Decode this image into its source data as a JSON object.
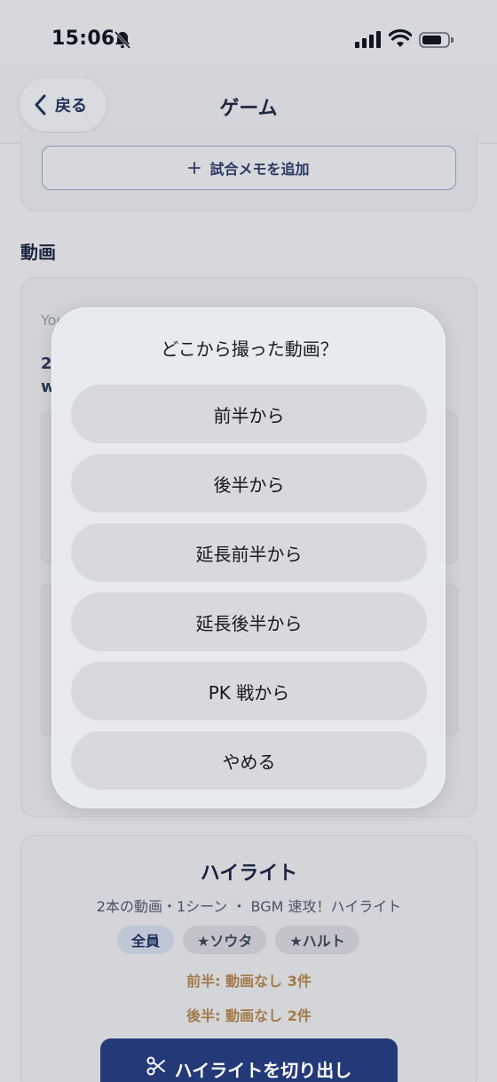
{
  "status_bar": {
    "time": "15:06"
  },
  "nav": {
    "back_label": "戻る",
    "title": "ゲーム"
  },
  "memo": {
    "add_label": "試合メモを追加"
  },
  "video_section": {
    "title": "動画",
    "hint": "You",
    "number": "2",
    "w": "w"
  },
  "highlight": {
    "title": "ハイライト",
    "subtitle": "2本の動画・1シーン ・ BGM 速攻！ハイライト",
    "chips": [
      "全員",
      "★ソウタ",
      "★ハルト"
    ],
    "warning_first_half": "前半: 動画なし 3件",
    "warning_second_half": "後半: 動画なし 2件",
    "cut_button_label": "ハイライトを切り出し"
  },
  "action_sheet": {
    "title": "どこから撮った動画？",
    "options": [
      "前半から",
      "後半から",
      "延長前半から",
      "延長後半から",
      "PK 戦から"
    ],
    "cancel": "やめる"
  },
  "colors": {
    "accent": "#243a78",
    "warning": "#a37a48"
  }
}
